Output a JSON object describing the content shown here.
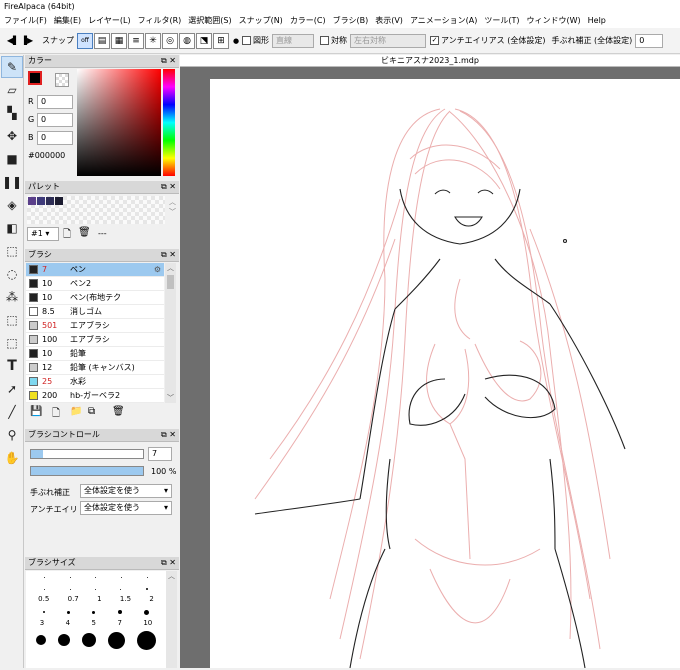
{
  "app": {
    "title": "FireAlpaca (64bit)"
  },
  "menu": [
    "ファイル(F)",
    "編集(E)",
    "レイヤー(L)",
    "フィルタ(R)",
    "選択範囲(S)",
    "スナップ(N)",
    "カラー(C)",
    "ブラシ(B)",
    "表示(V)",
    "アニメーション(A)",
    "ツール(T)",
    "ウィンドウ(W)",
    "Help"
  ],
  "toolbar": {
    "snap_label": "スナップ",
    "snap_off": "off",
    "shape_label": "図形",
    "shape_value": "直線",
    "symmetry_label": "対称",
    "symmetry_value": "左右対称",
    "antialias_label": "アンチエイリアス (全体設定)",
    "stabilizer_label": "手ぶれ補正 (全体設定)",
    "stabilizer_value": "0"
  },
  "color_panel": {
    "title": "カラー",
    "r_label": "R",
    "r_value": "0",
    "g_label": "G",
    "g_value": "0",
    "b_label": "B",
    "b_value": "0",
    "hex": "#000000",
    "primary": "#000000"
  },
  "palette_panel": {
    "title": "パレット",
    "selected": "#1",
    "dash": "---",
    "swatches": [
      "#5a3f8a",
      "#3e3a7a",
      "#2d2d55",
      "#1c1c30"
    ]
  },
  "brush_panel": {
    "title": "ブラシ",
    "brushes": [
      {
        "size": "7",
        "name": "ペン",
        "color": "#222222",
        "selected": true,
        "red": true
      },
      {
        "size": "10",
        "name": "ペン2",
        "color": "#222222"
      },
      {
        "size": "10",
        "name": "ペン(布地テク",
        "color": "#222222"
      },
      {
        "size": "8.5",
        "name": "消しゴム",
        "color": "#ffffff"
      },
      {
        "size": "501",
        "name": "エアブラシ",
        "color": "#cccccc",
        "red": true
      },
      {
        "size": "100",
        "name": "エアブラシ",
        "color": "#cccccc"
      },
      {
        "size": "10",
        "name": "鉛筆",
        "color": "#222222"
      },
      {
        "size": "12",
        "name": "鉛筆 (キャンバス)",
        "color": "#cccccc"
      },
      {
        "size": "25",
        "name": "水彩",
        "color": "#7fd8f0",
        "red": true
      },
      {
        "size": "200",
        "name": "hb-ガーベラ2",
        "color": "#f0e020"
      }
    ]
  },
  "brush_control": {
    "title": "ブラシコントロール",
    "size_value": "7",
    "opacity_value": "100",
    "opacity_unit": "%",
    "stabilizer_label": "手ぶれ補正",
    "stabilizer_value": "全体設定を使う",
    "antialias_label": "アンチエイリアス",
    "antialias_value": "全体設定を使う"
  },
  "brush_size": {
    "title": "ブラシサイズ",
    "labels_row1": [
      "0.5",
      "0.7",
      "1",
      "1.5",
      "2"
    ],
    "labels_row2": [
      "3",
      "4",
      "5",
      "7",
      "10"
    ]
  },
  "document": {
    "tab": "ビキニアスナ2023_1.mdp"
  }
}
